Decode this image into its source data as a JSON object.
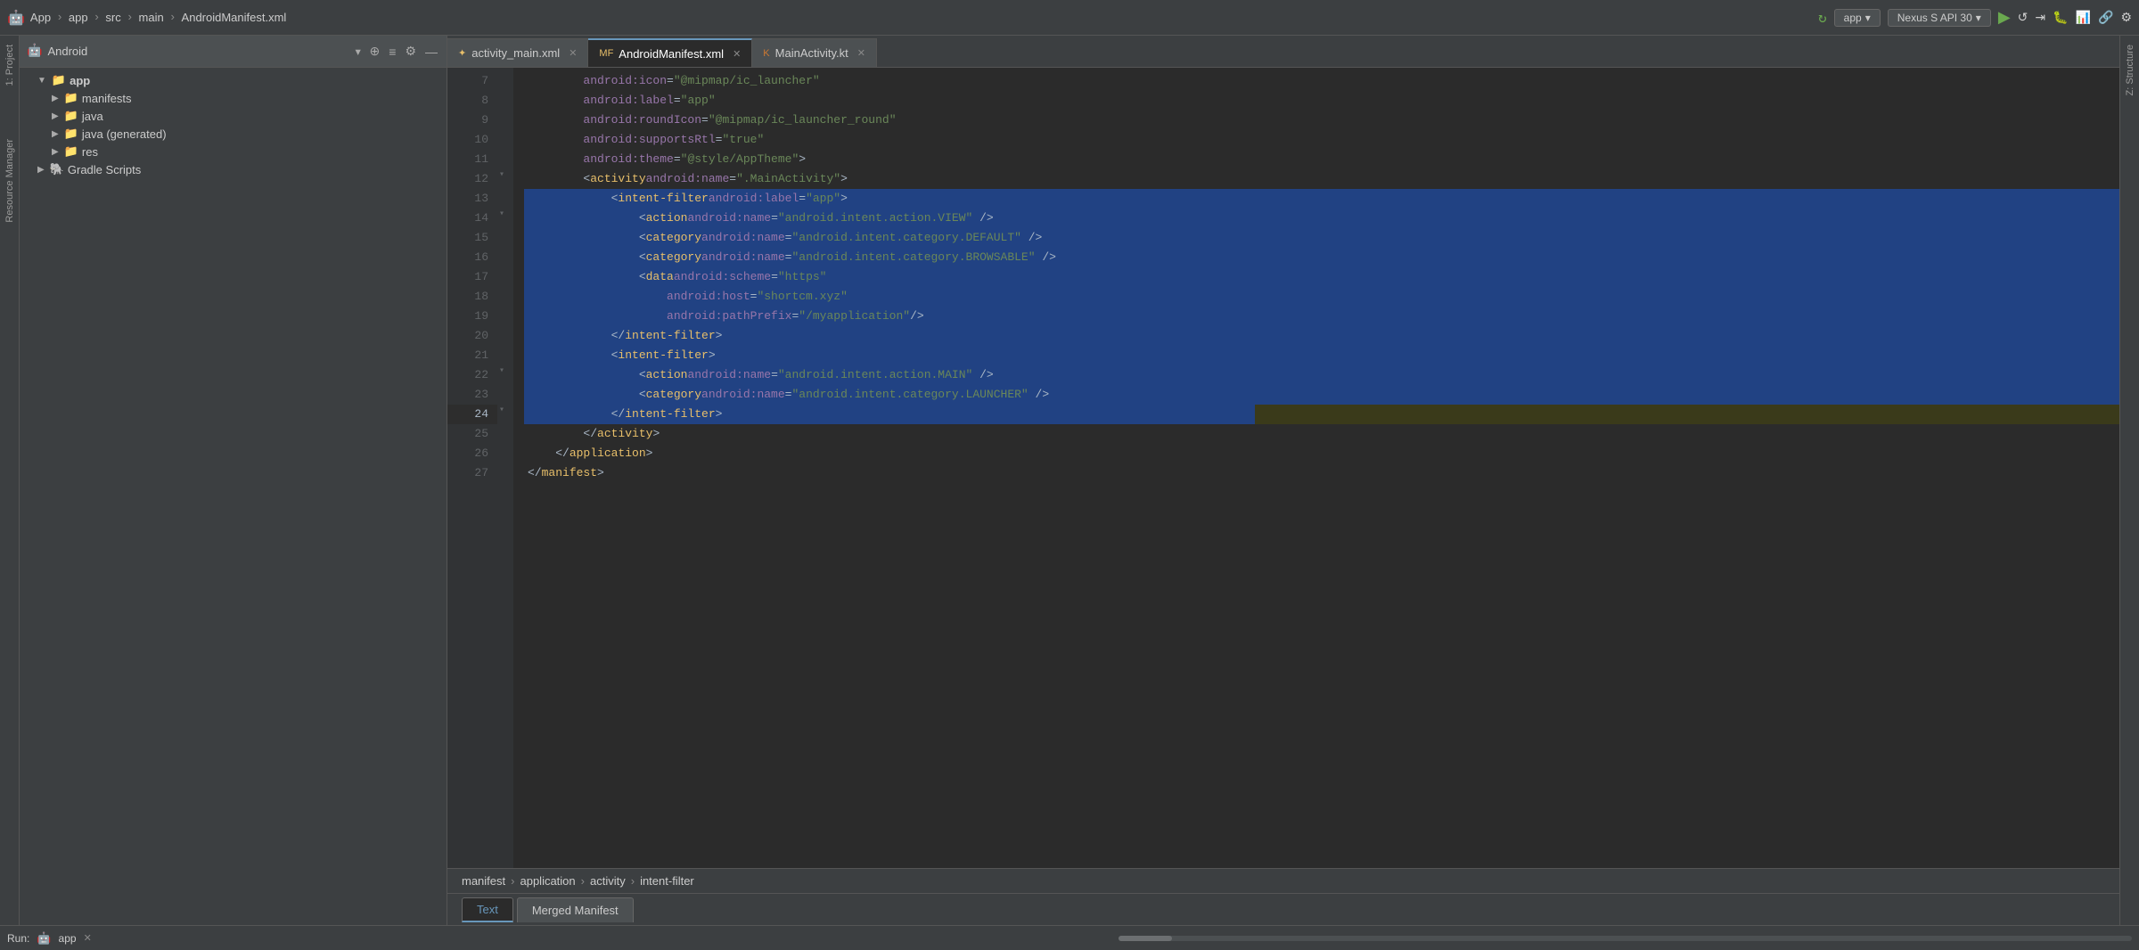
{
  "toolbar": {
    "app_icon": "🤖",
    "breadcrumb": [
      "App",
      "app",
      "src",
      "main",
      "AndroidManifest.xml"
    ],
    "run_config": "app",
    "device": "Nexus S API 30",
    "run_icon": "▶",
    "refresh_icon": "↺",
    "stop_icon": "⬛",
    "debug_icon": "🐞",
    "profile_icon": "📊",
    "sync_icon": "🔄"
  },
  "project_panel": {
    "title": "Android",
    "items": [
      {
        "indent": 1,
        "label": "app",
        "type": "folder",
        "expanded": true
      },
      {
        "indent": 2,
        "label": "manifests",
        "type": "folder",
        "expanded": false
      },
      {
        "indent": 2,
        "label": "java",
        "type": "folder",
        "expanded": false
      },
      {
        "indent": 2,
        "label": "java (generated)",
        "type": "folder-gen",
        "expanded": false
      },
      {
        "indent": 2,
        "label": "res",
        "type": "folder",
        "expanded": false
      },
      {
        "indent": 1,
        "label": "Gradle Scripts",
        "type": "gradle",
        "expanded": false
      }
    ]
  },
  "tabs": [
    {
      "label": "activity_main.xml",
      "type": "xml",
      "active": false
    },
    {
      "label": "AndroidManifest.xml",
      "type": "manifest",
      "active": true
    },
    {
      "label": "MainActivity.kt",
      "type": "kt",
      "active": false
    }
  ],
  "code": {
    "lines": [
      {
        "num": 7,
        "content": "        android:icon=\"@mipmap/ic_launcher\"",
        "highlight": false
      },
      {
        "num": 8,
        "content": "        android:label=\"app\"",
        "highlight": false
      },
      {
        "num": 9,
        "content": "        android:roundIcon=\"@mipmap/ic_launcher_round\"",
        "highlight": false
      },
      {
        "num": 10,
        "content": "        android:supportsRtl=\"true\"",
        "highlight": false
      },
      {
        "num": 11,
        "content": "        android:theme=\"@style/AppTheme\">",
        "highlight": false
      },
      {
        "num": 12,
        "content": "        <activity android:name=\".MainActivity\">",
        "highlight": false
      },
      {
        "num": 13,
        "content": "            <intent-filter android:label=\"app\">",
        "highlight": true
      },
      {
        "num": 14,
        "content": "                <action android:name=\"android.intent.action.VIEW\" />",
        "highlight": true
      },
      {
        "num": 15,
        "content": "                <category android:name=\"android.intent.category.DEFAULT\" />",
        "highlight": true
      },
      {
        "num": 16,
        "content": "                <category android:name=\"android.intent.category.BROWSABLE\" />",
        "highlight": true
      },
      {
        "num": 17,
        "content": "                <data android:scheme=\"https\"",
        "highlight": true
      },
      {
        "num": 18,
        "content": "                    android:host=\"shortcm.xyz\"",
        "highlight": true
      },
      {
        "num": 19,
        "content": "                    android:pathPrefix=\"/myapplication\"/>",
        "highlight": true
      },
      {
        "num": 20,
        "content": "            </intent-filter>",
        "highlight": true
      },
      {
        "num": 21,
        "content": "            <intent-filter>",
        "highlight": true
      },
      {
        "num": 22,
        "content": "                <action android:name=\"android.intent.action.MAIN\" />",
        "highlight": true
      },
      {
        "num": 23,
        "content": "                <category android:name=\"android.intent.category.LAUNCHER\" />",
        "highlight": true
      },
      {
        "num": 24,
        "content": "            </intent-filter>",
        "highlight": true,
        "current": true
      },
      {
        "num": 25,
        "content": "        </activity>",
        "highlight": false
      },
      {
        "num": 26,
        "content": "    </application>",
        "highlight": false
      },
      {
        "num": 27,
        "content": "</manifest>",
        "highlight": false
      }
    ]
  },
  "breadcrumb_bar": {
    "items": [
      "manifest",
      "application",
      "activity",
      "intent-filter"
    ]
  },
  "bottom_tabs": [
    {
      "label": "Text",
      "active": true
    },
    {
      "label": "Merged Manifest",
      "active": false
    }
  ],
  "run_bar": {
    "label": "Run:",
    "config": "app"
  },
  "side_tabs": {
    "left": [
      "1: Project",
      "Resource Manager"
    ],
    "right": [
      "Z: Structure"
    ]
  }
}
